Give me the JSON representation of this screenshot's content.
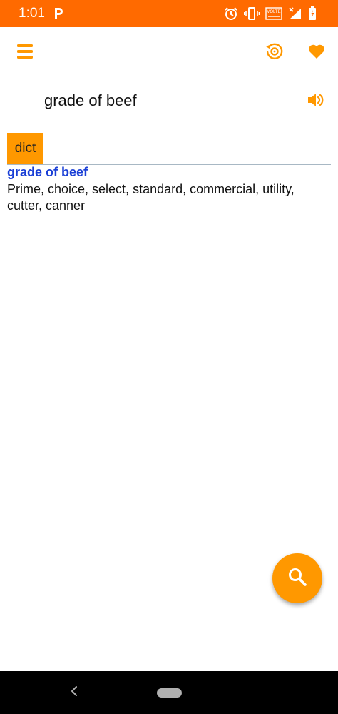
{
  "status_bar": {
    "time": "1:01",
    "icons": [
      "p-notification-icon",
      "alarm-icon",
      "vibrate-icon",
      "volte-icon",
      "signal-icon",
      "battery-icon"
    ],
    "volte_label": "VOLTE",
    "background": "#ff6a00"
  },
  "app_bar": {
    "icons": [
      "menu-icon",
      "history-icon",
      "heart-icon"
    ],
    "accent": "#ff9800"
  },
  "word": {
    "title": "grade of beef"
  },
  "tabs": [
    {
      "label": "dict",
      "selected": true
    }
  ],
  "definition": {
    "headword": "grade of beef",
    "body": "Prime, choice, select, standard, commercial, utility, cutter, canner",
    "headword_color": "#1a3fd6"
  },
  "fab": {
    "icon": "search-icon",
    "color": "#ff9800"
  },
  "nav_bar": {
    "icons": [
      "back-icon",
      "home-pill"
    ]
  }
}
